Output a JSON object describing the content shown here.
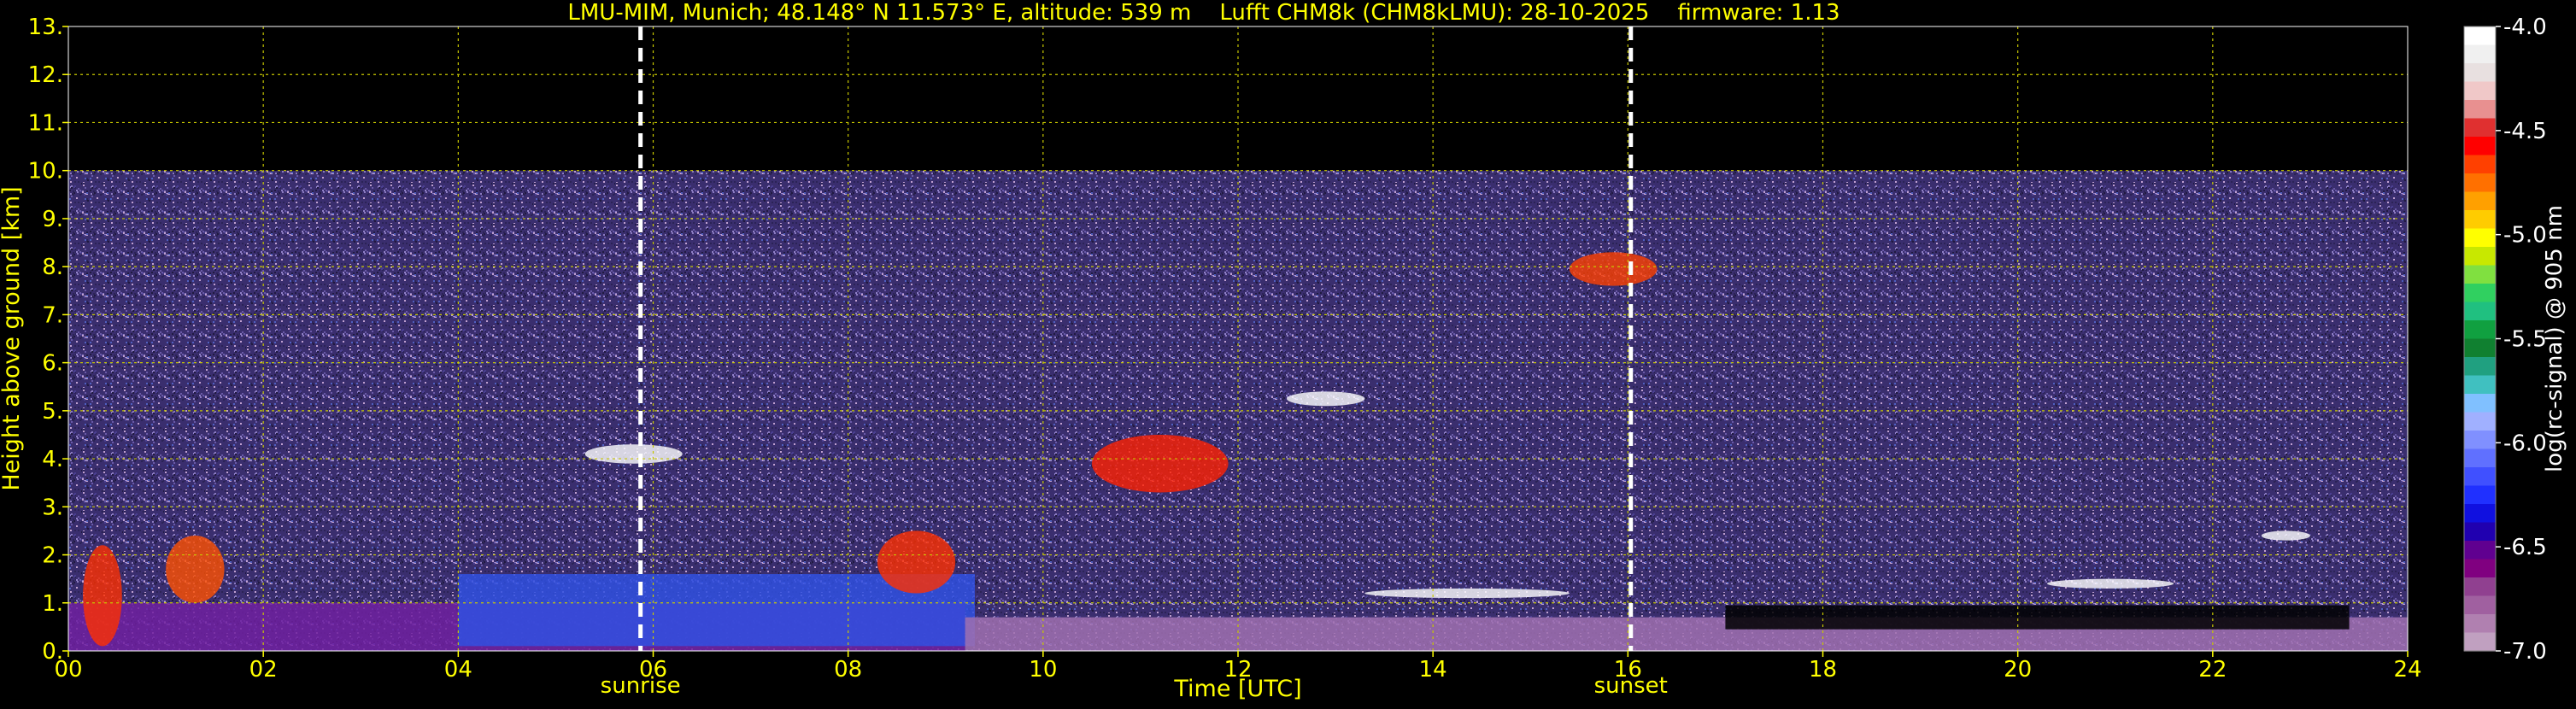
{
  "title": "LMU-MIM, Munich; 48.148° N 11.573° E, altitude: 539 m    Lufft CHM8k (CHM8kLMU): 28-10-2025    firmware: 1.13",
  "colors": {
    "axis_text": "#ffff00",
    "grid": "#c8c800",
    "marker_line": "#ffffff",
    "background": "#000000"
  },
  "chart_data": {
    "type": "heatmap",
    "xlabel": "Time [UTC]",
    "ylabel": "Height above ground [km]",
    "xlim": [
      0,
      24
    ],
    "ylim": [
      0,
      13
    ],
    "x_ticks": [
      "00",
      "02",
      "04",
      "06",
      "08",
      "10",
      "12",
      "14",
      "16",
      "18",
      "20",
      "22",
      "24"
    ],
    "y_ticks": [
      "0.",
      "1.",
      "2.",
      "3.",
      "4.",
      "5.",
      "6.",
      "7.",
      "8.",
      "9.",
      "10.",
      "11.",
      "12.",
      "13."
    ],
    "grid": true,
    "data_top_km": 10.0,
    "markers": [
      {
        "label": "sunrise",
        "time_h": 5.87
      },
      {
        "label": "sunset",
        "time_h": 16.03
      }
    ],
    "colorbar": {
      "label": "log(rc-signal) @ 905 nm",
      "range": [
        -7.0,
        -4.0
      ],
      "ticks": [
        "-4.0",
        "-4.5",
        "-5.0",
        "-5.5",
        "-6.0",
        "-6.5",
        "-7.0"
      ],
      "colors": [
        "#ffffff",
        "#f0f0f0",
        "#e8e0e0",
        "#f0c8c8",
        "#e89090",
        "#e03030",
        "#ff0000",
        "#ff4000",
        "#ff7000",
        "#ffa000",
        "#ffcc00",
        "#ffff00",
        "#c8e800",
        "#80e040",
        "#30d060",
        "#20c080",
        "#10a040",
        "#108030",
        "#20a080",
        "#40c0c0",
        "#80c0ff",
        "#a0b0ff",
        "#8090ff",
        "#6070ff",
        "#4050ff",
        "#2030ff",
        "#1010e0",
        "#2000b0",
        "#600090",
        "#800080",
        "#904090",
        "#a060a0",
        "#b080b0",
        "#c0a0c0"
      ]
    },
    "layers": [
      {
        "name": "residual-layer",
        "t0": 0.0,
        "t1": 9.2,
        "z0": 0.0,
        "z1": 1.0,
        "color": "#7020a0"
      },
      {
        "name": "boundary-layer-blue",
        "t0": 4.0,
        "t1": 9.3,
        "z0": 0.1,
        "z1": 1.6,
        "color": "#3050e0"
      },
      {
        "name": "surface-layer-pink",
        "t0": 9.2,
        "t1": 24.0,
        "z0": 0.0,
        "z1": 0.7,
        "color": "#a070b0"
      },
      {
        "name": "clear-gap",
        "t0": 17.0,
        "t1": 23.4,
        "z0": 0.45,
        "z1": 0.95,
        "color": "#000000"
      }
    ],
    "clouds": [
      {
        "t0": 0.15,
        "t1": 0.55,
        "z0": 0.1,
        "z1": 2.2,
        "color": "#ff3000"
      },
      {
        "t0": 1.0,
        "t1": 1.6,
        "z0": 1.0,
        "z1": 2.4,
        "color": "#ff5000"
      },
      {
        "t0": 5.3,
        "t1": 6.3,
        "z0": 3.9,
        "z1": 4.3,
        "color": "#ffffff"
      },
      {
        "t0": 8.3,
        "t1": 9.1,
        "z0": 1.2,
        "z1": 2.5,
        "color": "#ff3000"
      },
      {
        "t0": 10.5,
        "t1": 11.9,
        "z0": 3.3,
        "z1": 4.5,
        "color": "#ff2000"
      },
      {
        "t0": 15.4,
        "t1": 16.3,
        "z0": 7.6,
        "z1": 8.3,
        "color": "#ff4000"
      },
      {
        "t0": 13.3,
        "t1": 15.4,
        "z0": 1.1,
        "z1": 1.3,
        "color": "#ffffff"
      },
      {
        "t0": 20.3,
        "t1": 21.6,
        "z0": 1.3,
        "z1": 1.5,
        "color": "#ffffff"
      },
      {
        "t0": 22.5,
        "t1": 23.0,
        "z0": 2.3,
        "z1": 2.5,
        "color": "#ffffff"
      },
      {
        "t0": 12.5,
        "t1": 13.3,
        "z0": 5.1,
        "z1": 5.4,
        "color": "#ffffff"
      }
    ]
  }
}
